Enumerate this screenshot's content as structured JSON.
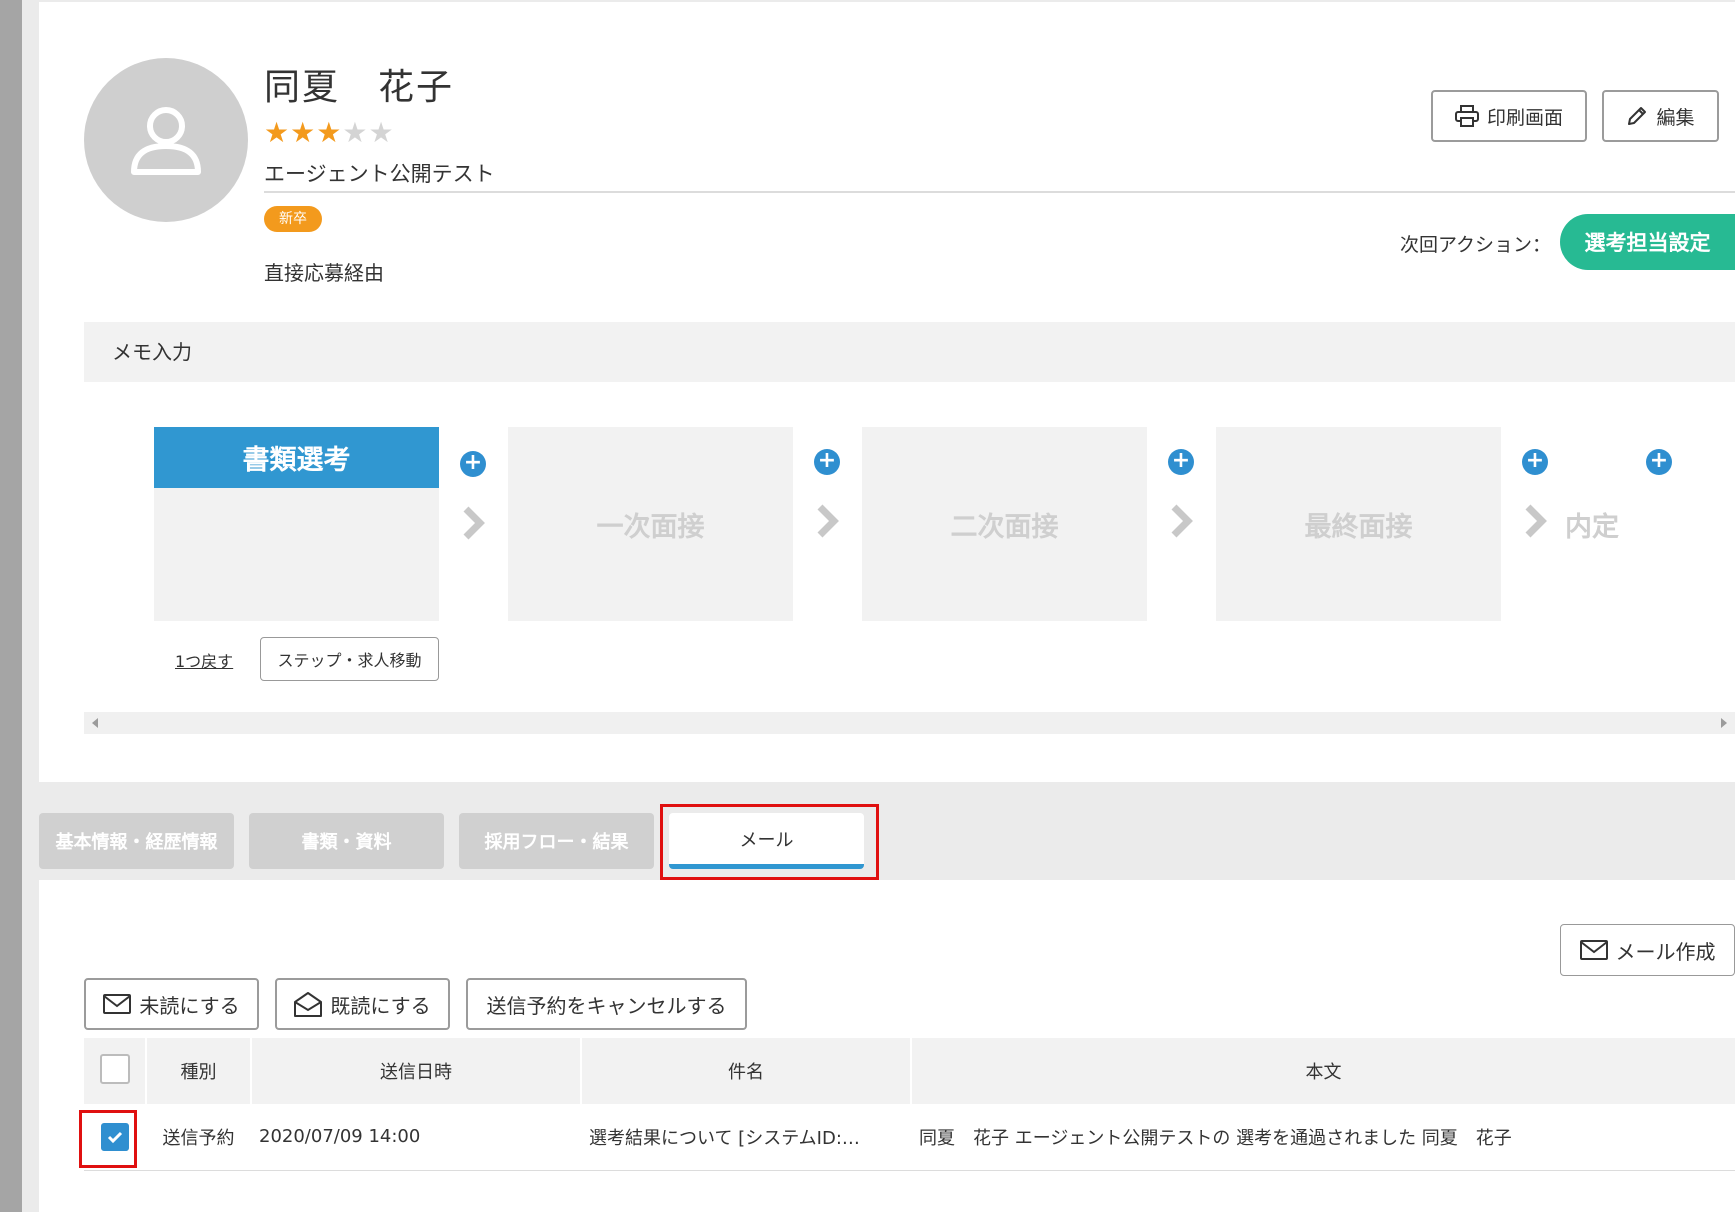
{
  "profile": {
    "name": "同夏　花子",
    "rating": 3,
    "rating_max": 5,
    "company": "エージェント公開テスト",
    "badge": "新卒",
    "source": "直接応募経由"
  },
  "header_buttons": {
    "print_label": "印刷画面",
    "edit_label": "編集"
  },
  "next_action": {
    "label": "次回アクション：",
    "button_label": "選考担当設定"
  },
  "memo": {
    "label": "メモ入力"
  },
  "flow": {
    "steps": [
      "書類選考",
      "一次面接",
      "二次面接",
      "最終面接",
      "内定"
    ],
    "active_step": "書類選考",
    "back_label": "1つ戻す",
    "move_label": "ステップ・求人移動"
  },
  "tabs": [
    {
      "label": "基本情報・経歴情報",
      "active": false
    },
    {
      "label": "書類・資料",
      "active": false
    },
    {
      "label": "採用フロー・結果",
      "active": false
    },
    {
      "label": "メール",
      "active": true
    }
  ],
  "mail": {
    "compose_label": "メール作成",
    "unread_label": "未読にする",
    "read_label": "既読にする",
    "cancel_label": "送信予約をキャンセルする",
    "columns": [
      "種別",
      "送信日時",
      "件名",
      "本文"
    ],
    "rows": [
      {
        "type": "送信予約",
        "datetime": "2020/07/09 14:00",
        "subject": "選考結果について [システムID:…",
        "body": "同夏　花子 エージェント公開テストの 選考を通過されました 同夏　花子",
        "checked": true
      }
    ]
  },
  "colors": {
    "accent_blue": "#3097d1",
    "action_green": "#27ba93",
    "star_orange": "#f39a1d",
    "highlight_red": "#e01010"
  }
}
